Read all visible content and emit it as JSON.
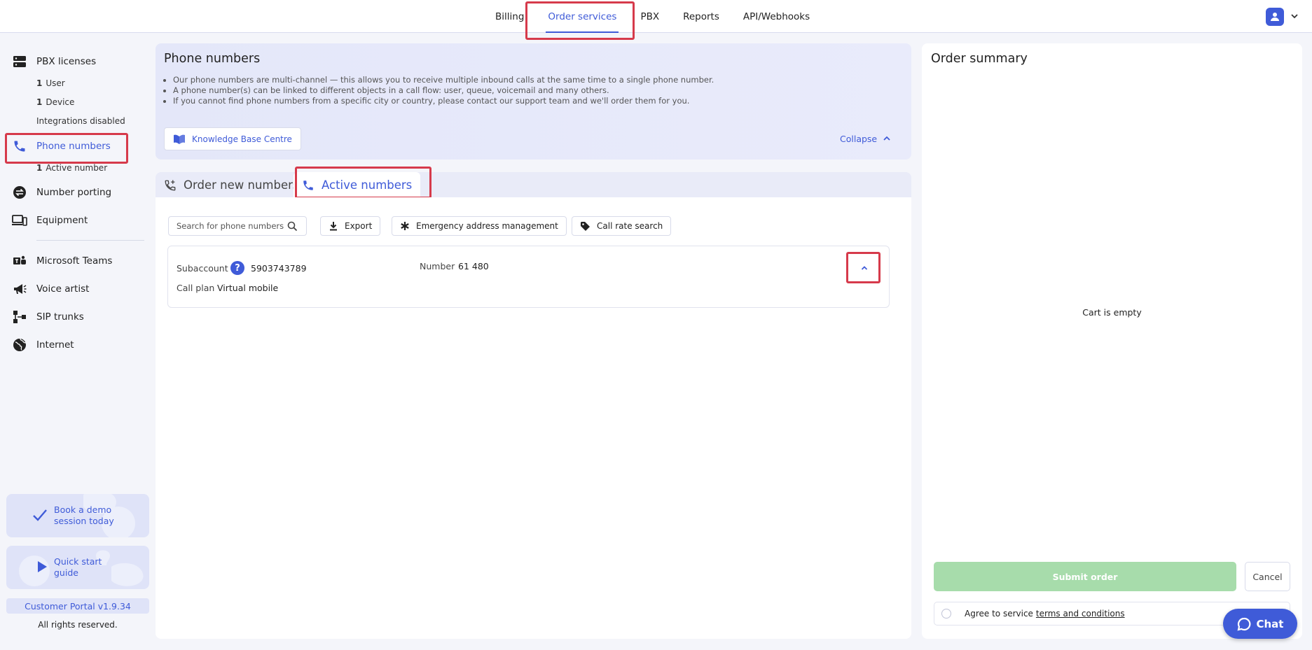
{
  "topnav": {
    "tabs": [
      "Billing",
      "Order services",
      "PBX",
      "Reports",
      "API/Webhooks"
    ]
  },
  "sidebar": {
    "pbx_licenses": "PBX licenses",
    "sub_user_count": "1",
    "sub_user_label": "User",
    "sub_device_count": "1",
    "sub_device_label": "Device",
    "sub_integrations": "Integrations disabled",
    "phone_numbers": "Phone numbers",
    "sub_active_count": "1",
    "sub_active_label": "Active number",
    "number_porting": "Number porting",
    "equipment": "Equipment",
    "microsoft_teams": "Microsoft Teams",
    "voice_artist": "Voice artist",
    "sip_trunks": "SIP trunks",
    "internet": "Internet",
    "demo_line1": "Book a demo",
    "demo_line2": "session today",
    "guide_line1": "Quick start",
    "guide_line2": "guide",
    "version": "Customer Portal v1.9.34",
    "rights": "All rights reserved."
  },
  "info": {
    "title": "Phone numbers",
    "bullets": [
      "Our phone numbers are multi-channel — this allows you to receive multiple inbound calls at the same time to a single phone number.",
      "A phone number(s) can be linked to different objects in a call flow: user, queue, voicemail and many others.",
      "If you cannot find phone numbers from a specific city or country, please contact our support team and we'll order them for you."
    ],
    "kb_button": "Knowledge Base Centre",
    "collapse": "Collapse"
  },
  "numbers_tabs": {
    "order_new": "Order new numbers",
    "active": "Active numbers"
  },
  "toolbar": {
    "search_placeholder": "Search for phone numbers",
    "export": "Export",
    "emergency": "Emergency address management",
    "call_rate": "Call rate search"
  },
  "card": {
    "subaccount_label": "Subaccount",
    "subaccount_help": "?",
    "subaccount_value": "5903743789",
    "number_label": "Number",
    "number_value": "61 480",
    "call_plan_label": "Call plan",
    "call_plan_value": "Virtual mobile"
  },
  "summary": {
    "title": "Order summary",
    "empty": "Cart is empty",
    "submit": "Submit order",
    "cancel": "Cancel",
    "agree": "Agree to service",
    "terms_link": "terms and conditions"
  },
  "chat": {
    "label": "Chat"
  },
  "colors": {
    "accent": "#3f5bd8",
    "highlight": "#d63a4b",
    "submit_disabled": "#a7dcab"
  }
}
